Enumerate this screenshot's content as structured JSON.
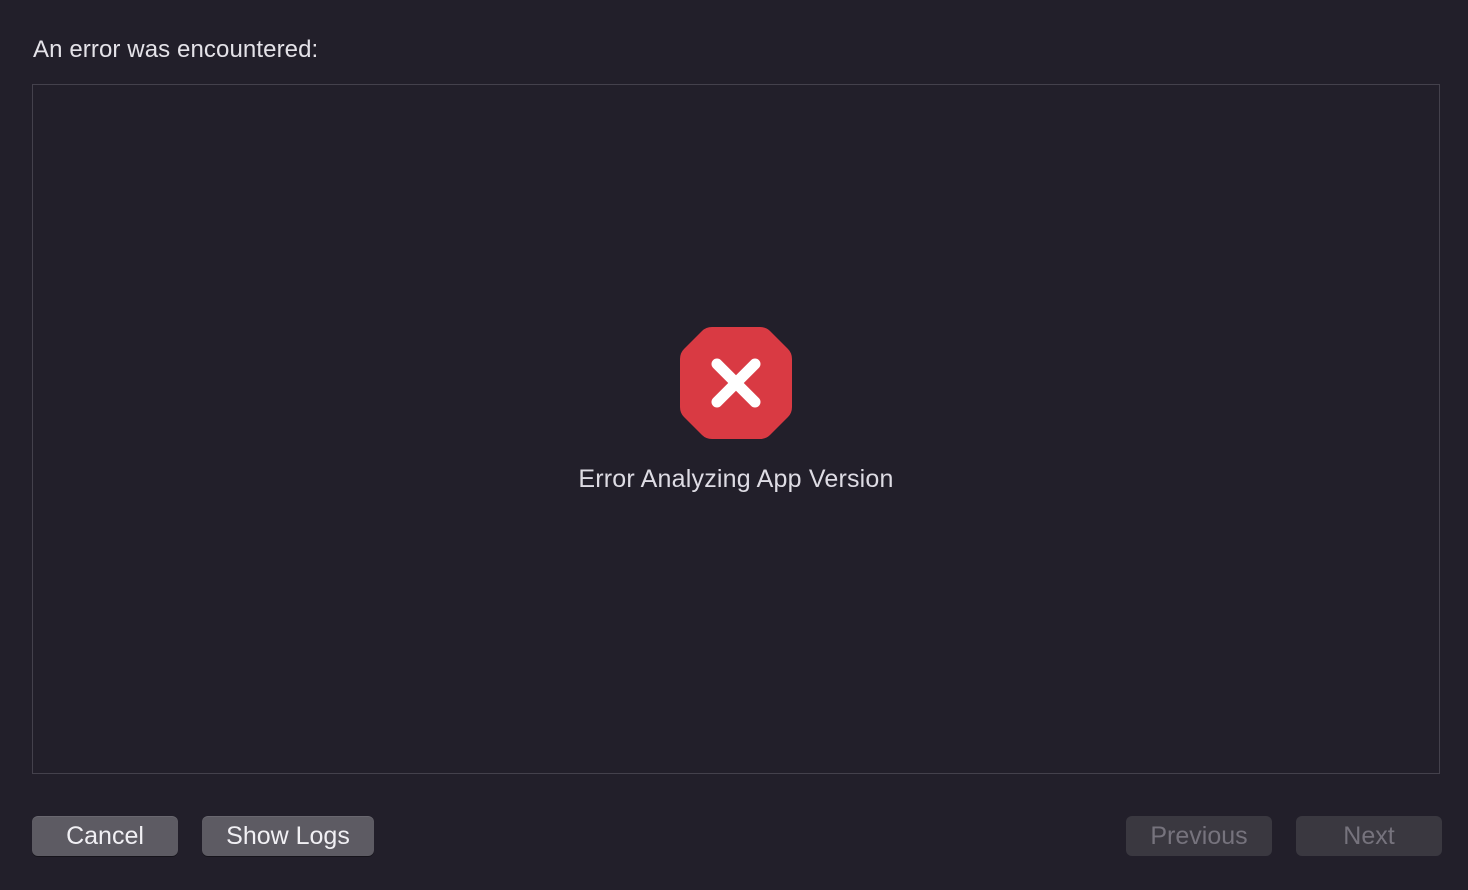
{
  "dialog": {
    "heading": "An error was encountered:"
  },
  "status": {
    "icon": "error-octagon-icon",
    "message": "Error Analyzing App Version"
  },
  "buttons": {
    "cancel": "Cancel",
    "show_logs": "Show Logs",
    "previous": "Previous",
    "next": "Next"
  },
  "colors": {
    "background": "#221f2a",
    "error_red": "#d93a43",
    "button_enabled": "#5d5b63",
    "button_disabled": "#3a3840"
  }
}
